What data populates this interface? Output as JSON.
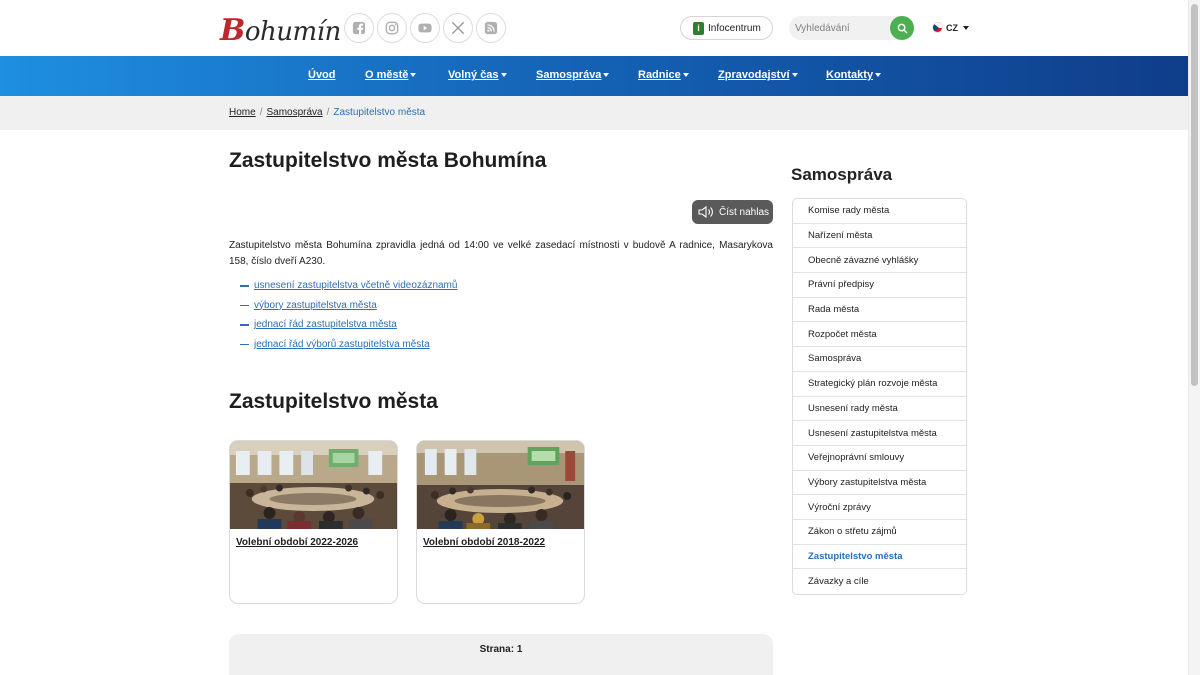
{
  "header": {
    "logo_initial": "B",
    "logo_rest": "ohumín",
    "social_icons": [
      "facebook-icon",
      "instagram-icon",
      "youtube-icon",
      "x-icon",
      "rss-icon"
    ],
    "infocentrum_label": "Infocentrum",
    "infocentrum_icon_glyph": "i",
    "search_placeholder": "Vyhledávání",
    "lang_label": "CZ"
  },
  "nav": {
    "items": [
      {
        "label": "Úvod",
        "dropdown": false
      },
      {
        "label": "O městě",
        "dropdown": true
      },
      {
        "label": "Volný čas",
        "dropdown": true
      },
      {
        "label": "Samospráva",
        "dropdown": true
      },
      {
        "label": "Radnice",
        "dropdown": true
      },
      {
        "label": "Zpravodajství",
        "dropdown": true
      },
      {
        "label": "Kontakty",
        "dropdown": true
      }
    ]
  },
  "breadcrumb": {
    "home": "Home",
    "section": "Samospráva",
    "current": "Zastupitelstvo města",
    "separator": "/"
  },
  "main": {
    "title": "Zastupitelstvo města Bohumína",
    "read_aloud_label": "Číst nahlas",
    "intro": "Zastupitelstvo města Bohumína zpravidla jedná od 14:00 ve velké zasedací místnosti v budově A radnice, Masarykova 158, číslo dveří A230.",
    "links": [
      "usnesení zastupitelstva včetně videozáznamů",
      "výbory zastupitelstva města",
      "jednací řád zastupitelstva města",
      "jednací řád výborů zastupitelstva města"
    ],
    "section_title": "Zastupitelstvo města",
    "cards": [
      {
        "title": "Volební období 2022-2026"
      },
      {
        "title": "Volební období 2018-2022"
      }
    ],
    "pager_label": "Strana: 1"
  },
  "sidebar": {
    "title": "Samospráva",
    "items": [
      "Komise rady města",
      "Nařízení města",
      "Obecně závazné vyhlášky",
      "Právní předpisy",
      "Rada města",
      "Rozpočet města",
      "Samospráva",
      "Strategický plán rozvoje města",
      "Usnesení rady města",
      "Usnesení zastupitelstva města",
      "Veřejnoprávní smlouvy",
      "Výbory zastupitelstva města",
      "Výroční zprávy",
      "Zákon o střetu zájmů",
      "Zastupitelstvo města",
      "Závazky a cíle"
    ],
    "active_index": 14
  },
  "colors": {
    "nav_start": "#1f8fe0",
    "nav_end": "#0f3d8a",
    "link": "#2b6fb6",
    "search_button": "#4caf50",
    "logo_accent": "#c0272d"
  }
}
